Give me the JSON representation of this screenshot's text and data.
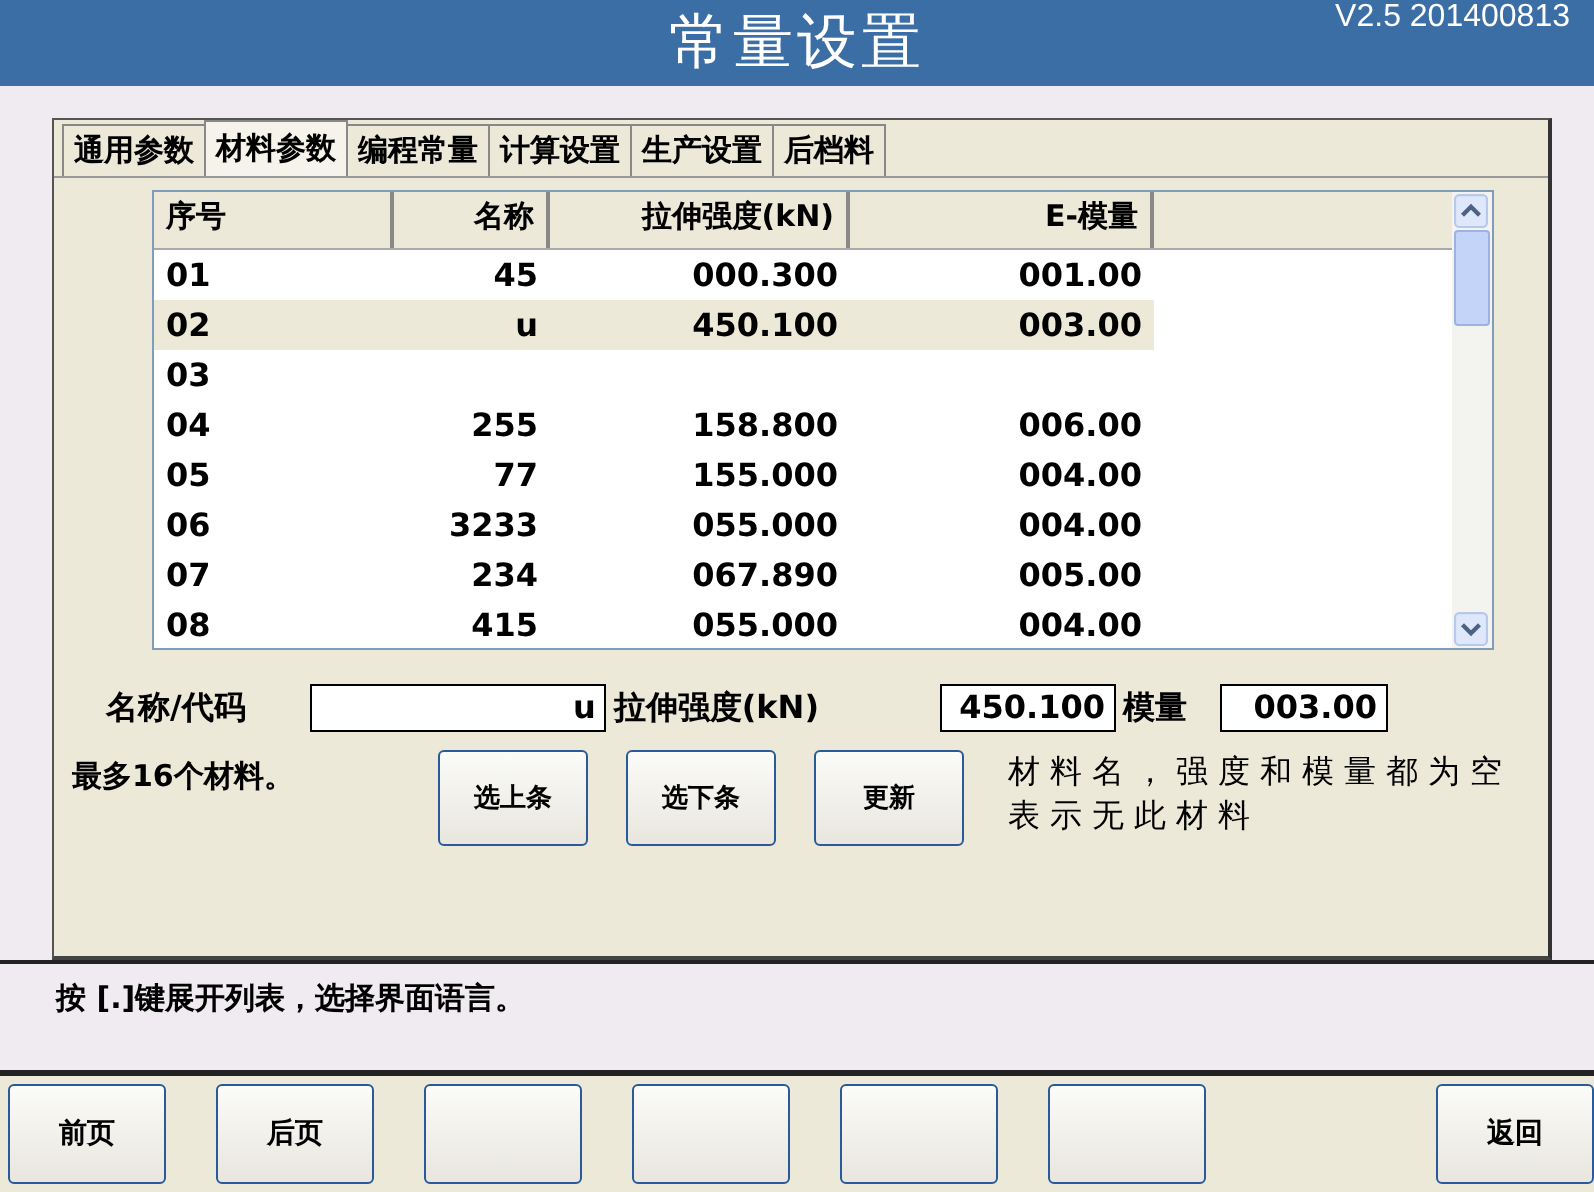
{
  "header": {
    "title": "常量设置",
    "version": "V2.5 201400813"
  },
  "tabs": [
    {
      "label": "通用参数",
      "selected": false
    },
    {
      "label": "材料参数",
      "selected": true
    },
    {
      "label": "编程常量",
      "selected": false
    },
    {
      "label": "计算设置",
      "selected": false
    },
    {
      "label": "生产设置",
      "selected": false
    },
    {
      "label": "后档料",
      "selected": false
    }
  ],
  "table": {
    "columns": [
      "序号",
      "名称",
      "拉伸强度(kN)",
      "E-模量"
    ],
    "rows": [
      {
        "cells": [
          "01",
          "45",
          "000.300",
          "001.00"
        ],
        "selected": false
      },
      {
        "cells": [
          "02",
          "u",
          "450.100",
          "003.00"
        ],
        "selected": true
      },
      {
        "cells": [
          "03"
        ],
        "selected": false
      },
      {
        "cells": [
          "04",
          "255",
          "158.800",
          "006.00"
        ],
        "selected": false
      },
      {
        "cells": [
          "05",
          "77",
          "155.000",
          "004.00"
        ],
        "selected": false
      },
      {
        "cells": [
          "06",
          "3233",
          "055.000",
          "004.00"
        ],
        "selected": false
      },
      {
        "cells": [
          "07",
          "234",
          "067.890",
          "005.00"
        ],
        "selected": false
      },
      {
        "cells": [
          "08",
          "415",
          "055.000",
          "004.00"
        ],
        "selected": false
      }
    ]
  },
  "form": {
    "name_label": "名称/代码",
    "name_value": "u",
    "strength_label": "拉伸强度(kN)",
    "strength_value": "450.100",
    "modulus_label": "模量",
    "modulus_value": "003.00"
  },
  "note": "最多16个材料。",
  "actions": [
    "选上条",
    "选下条",
    "更新"
  ],
  "hint": "材料名，强度和模量都为空表示无此材料",
  "message": "按 [.]键展开列表，选择界面语言。",
  "footer_buttons": [
    {
      "kind": "label",
      "label": "前页"
    },
    {
      "kind": "label",
      "label": "后页"
    },
    {
      "kind": "blank"
    },
    {
      "kind": "blank"
    },
    {
      "kind": "blank"
    },
    {
      "kind": "blank"
    },
    {
      "kind": "spacer"
    },
    {
      "kind": "label",
      "label": "返回"
    }
  ]
}
